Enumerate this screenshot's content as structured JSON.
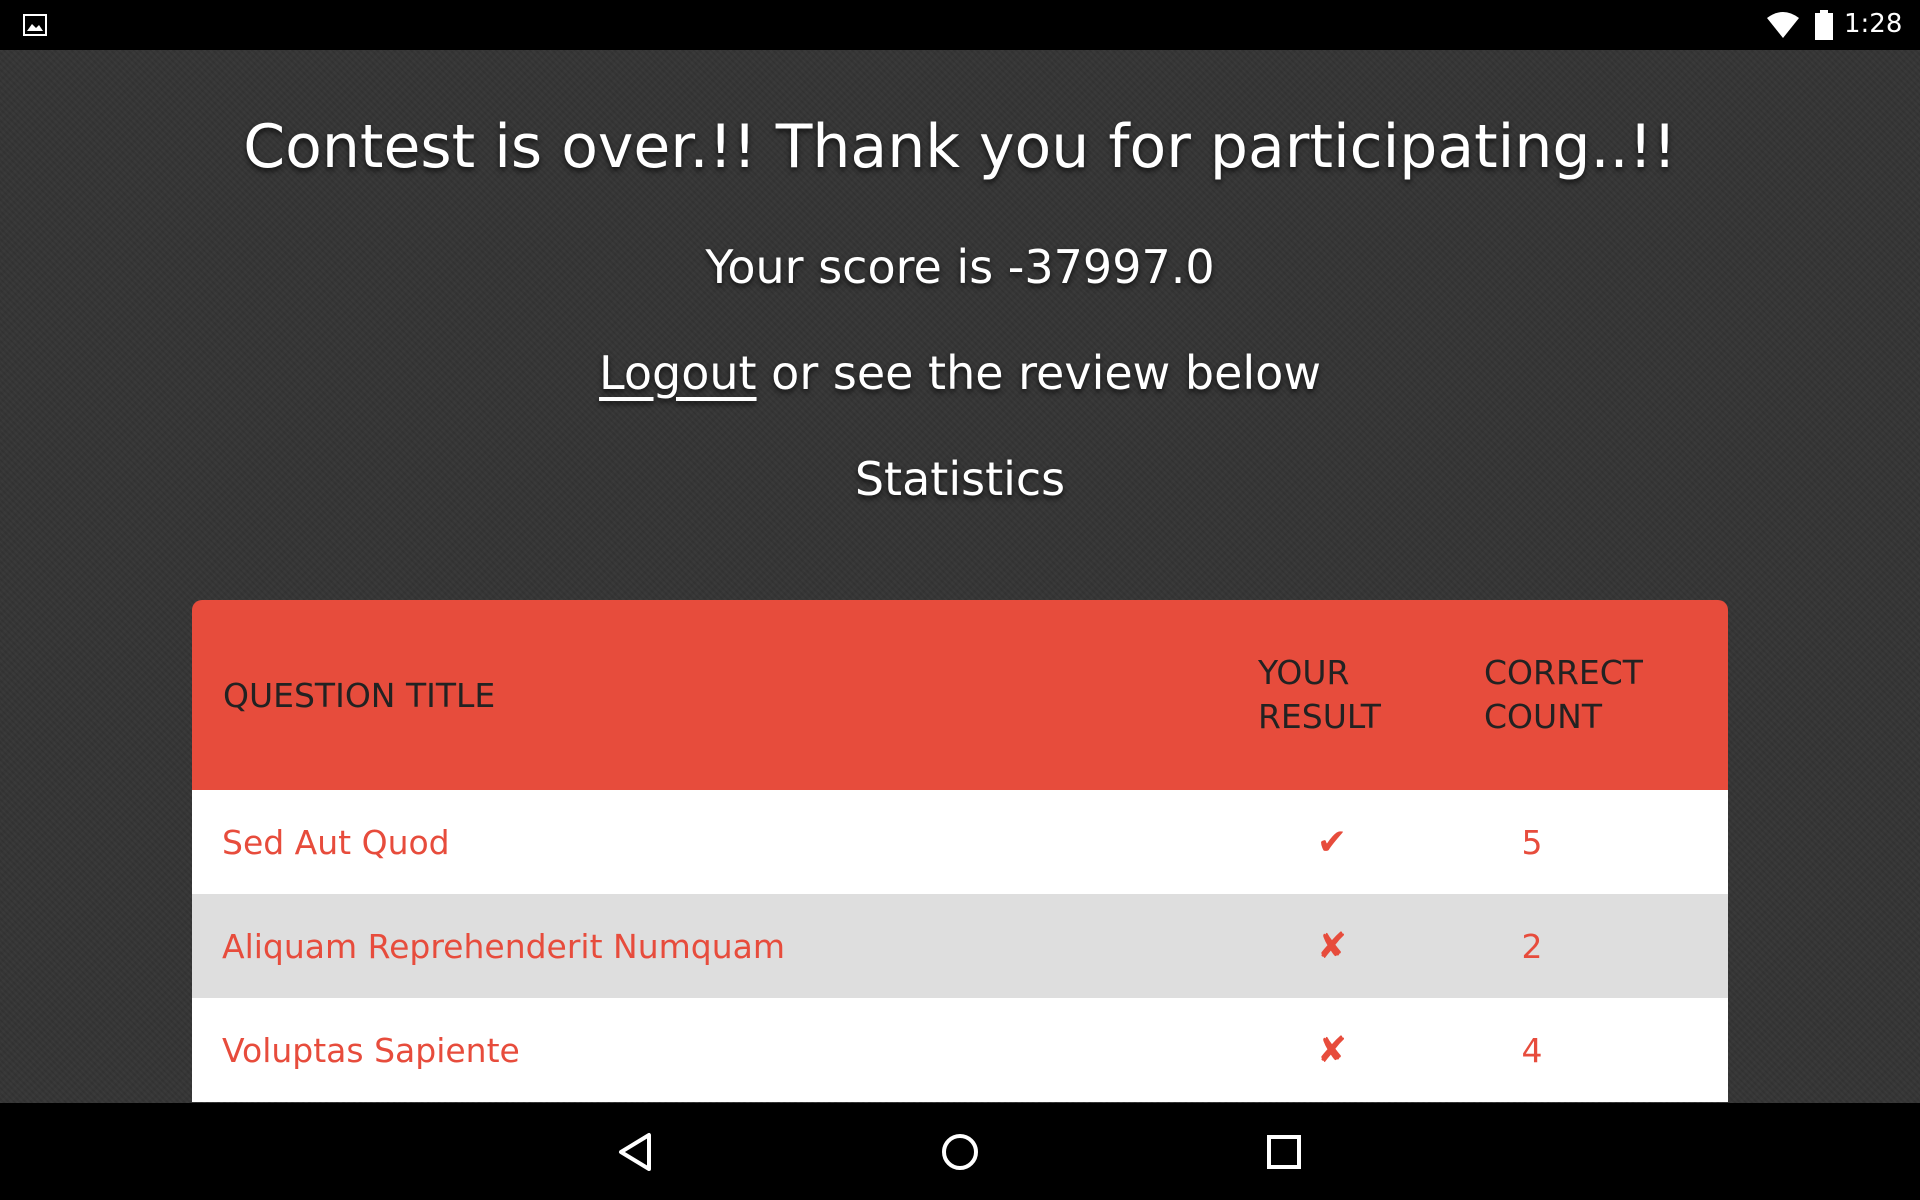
{
  "status_bar": {
    "time": "1:28",
    "icons": [
      "image-notification-icon",
      "wifi-icon",
      "battery-icon"
    ]
  },
  "page": {
    "headline": "Contest is over.!! Thank you for participating..!!",
    "score_text": "Your score is -37997.0",
    "logout_link": "Logout",
    "logout_suffix": " or see the review below",
    "statistics_title": "Statistics"
  },
  "table": {
    "headers": {
      "question_title": "QUESTION TITLE",
      "your_result_1": "YOUR",
      "your_result_2": "RESULT",
      "correct_count_1": "CORRECT",
      "correct_count_2": "COUNT"
    },
    "rows": [
      {
        "title": "Sed Aut Quod",
        "result": "✔",
        "correct_count": "5"
      },
      {
        "title": "Aliquam Reprehenderit Numquam",
        "result": "✘",
        "correct_count": "2"
      },
      {
        "title": "Voluptas Sapiente",
        "result": "✘",
        "correct_count": "4"
      }
    ]
  },
  "nav_bar": {
    "buttons": [
      "back-icon",
      "home-icon",
      "recents-icon"
    ]
  },
  "colors": {
    "accent": "#e74c3c",
    "background": "#343434",
    "row_alt": "#dedede"
  }
}
